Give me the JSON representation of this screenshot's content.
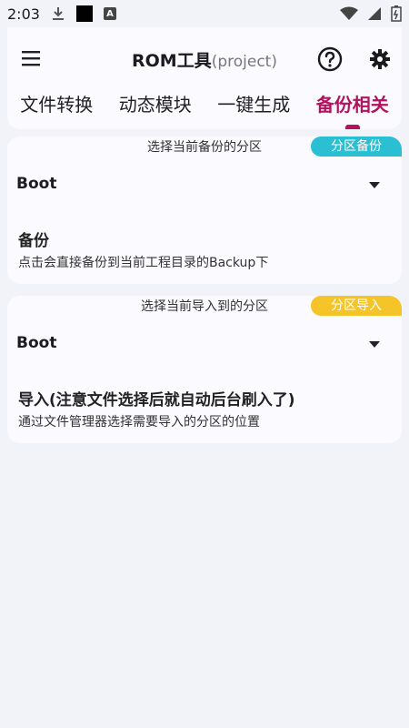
{
  "status_bar": {
    "time": "2:03",
    "icons": [
      "download-icon",
      "black-square-icon",
      "a-icon",
      "wifi-icon",
      "signal-icon",
      "battery-icon"
    ],
    "a_icon_text": "A"
  },
  "app_bar": {
    "title": "ROM工具",
    "subtitle": "(project)",
    "accent_color": "#b3125f"
  },
  "tabs": [
    {
      "label": "文件转换"
    },
    {
      "label": "动态模块"
    },
    {
      "label": "一键生成"
    },
    {
      "label": "备份相关",
      "active": true
    }
  ],
  "backup_card": {
    "header": "选择当前备份的分区",
    "badge": "分区备份",
    "badge_color": "#2bbfd3",
    "dropdown_value": "Boot",
    "action_title": "备份",
    "action_desc": "点击会直接备份到当前工程目录的Backup下"
  },
  "import_card": {
    "header": "选择当前导入到的分区",
    "badge": "分区导入",
    "badge_color": "#f5c428",
    "dropdown_value": "Boot",
    "action_title": "导入(注意文件选择后就自动后台刷入了)",
    "action_desc": "通过文件管理器选择需要导入的分区的位置"
  }
}
